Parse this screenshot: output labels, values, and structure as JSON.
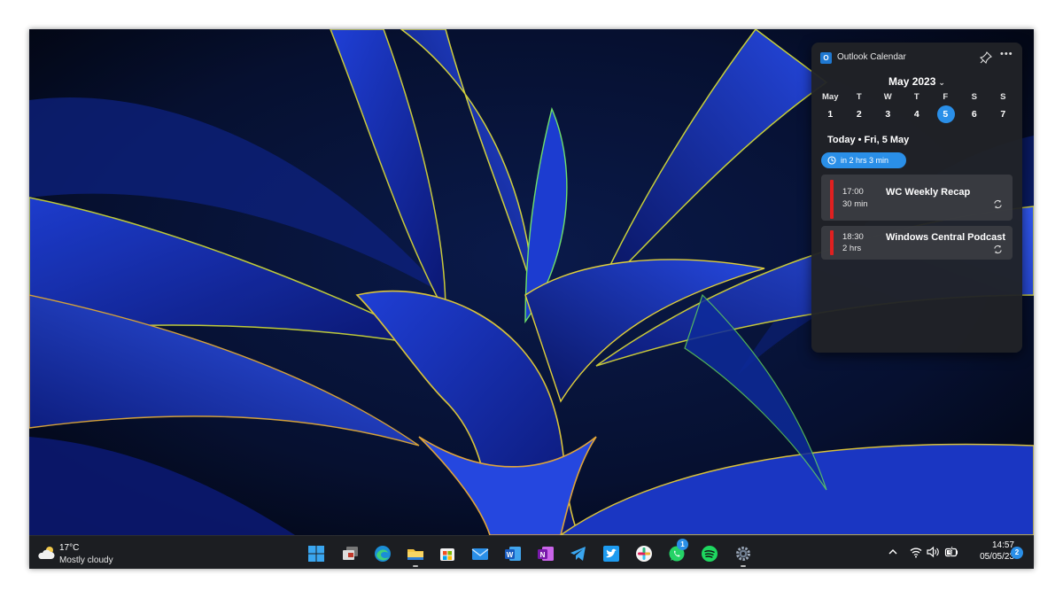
{
  "widget": {
    "app_title": "Outlook Calendar",
    "logo_letter": "O",
    "pin_icon": "pin-icon",
    "more_label": "•••",
    "month_label": "May 2023",
    "weekdays": [
      "May",
      "T",
      "W",
      "T",
      "F",
      "S",
      "S"
    ],
    "dates": [
      "1",
      "2",
      "3",
      "4",
      "5",
      "6",
      "7"
    ],
    "selected_date": "5",
    "today_label": "Today • Fri, 5 May",
    "countdown_label": "in 2 hrs 3 min",
    "accent_color": "#2a8fe8",
    "event_color": "#e02020",
    "events": [
      {
        "time": "17:00",
        "duration": "30 min",
        "title": "WC Weekly Recap",
        "icon": "repeat-icon"
      },
      {
        "time": "18:30",
        "duration": "2 hrs",
        "title": "Windows Central Podcast",
        "icon": "repeat-icon"
      }
    ]
  },
  "taskbar": {
    "weather": {
      "temp": "17°C",
      "condition": "Mostly cloudy",
      "icon": "cloud-sun-icon"
    },
    "apps": [
      {
        "name": "start-icon"
      },
      {
        "name": "task-view-icon"
      },
      {
        "name": "edge-icon"
      },
      {
        "name": "file-explorer-icon"
      },
      {
        "name": "store-icon"
      },
      {
        "name": "mail-icon"
      },
      {
        "name": "word-icon"
      },
      {
        "name": "onenote-icon"
      },
      {
        "name": "telegram-icon"
      },
      {
        "name": "twitter-icon"
      },
      {
        "name": "slack-icon"
      },
      {
        "name": "whatsapp-icon",
        "badge": "1"
      },
      {
        "name": "spotify-icon"
      },
      {
        "name": "settings-icon"
      }
    ],
    "tray": [
      "chevron-up-icon",
      "wifi-icon",
      "volume-icon",
      "battery-icon"
    ],
    "time": "14:57",
    "date": "05/05/23",
    "notifications": "2"
  }
}
